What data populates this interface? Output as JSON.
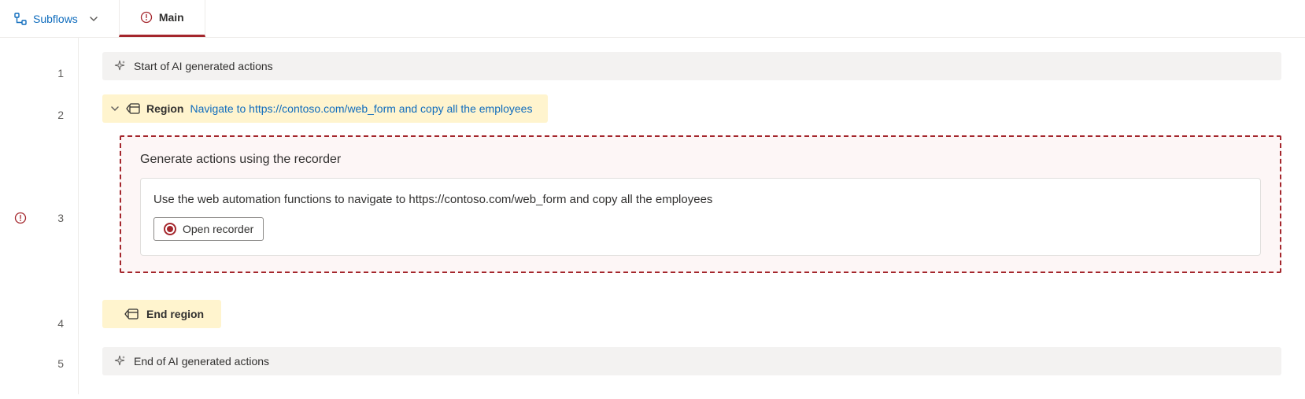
{
  "topbar": {
    "subflows_label": "Subflows",
    "tab_label": "Main"
  },
  "lines": {
    "l1": "1",
    "l2": "2",
    "l3": "3",
    "l4": "4",
    "l5": "5"
  },
  "actions": {
    "start_label": "Start of AI generated actions",
    "region_label": "Region",
    "region_desc": "Navigate to https://contoso.com/web_form and copy all the employees",
    "end_region_label": "End region",
    "end_label": "End of AI generated actions"
  },
  "recorder": {
    "title": "Generate actions using the recorder",
    "description": "Use the web automation functions to navigate to https://contoso.com/web_form and copy all the employees",
    "button_label": "Open recorder"
  }
}
